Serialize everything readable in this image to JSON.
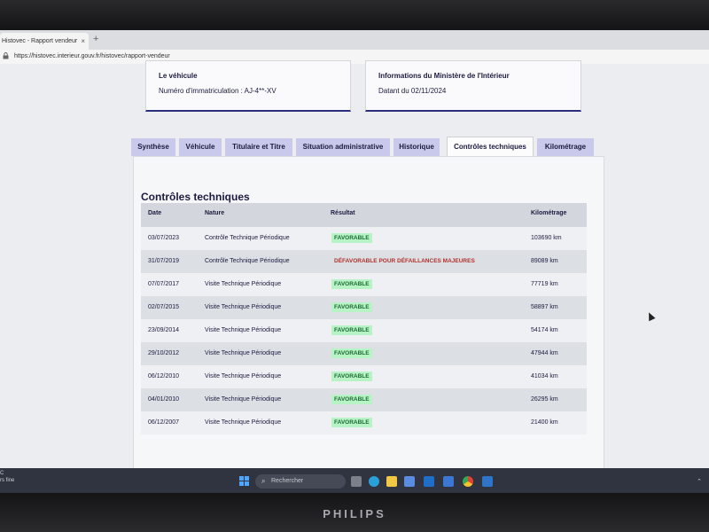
{
  "browser": {
    "tab_title": "Histovec - Rapport vendeur",
    "tab_close": "×",
    "new_tab": "+",
    "url": "https://histovec.interieur.gouv.fr/histovec/rapport-vendeur"
  },
  "cards": {
    "vehicle": {
      "title": "Le véhicule",
      "text": "Numéro d'immatriculation : AJ-4**-XV"
    },
    "ministry": {
      "title": "Informations du Ministère de l'Intérieur",
      "text": "Datant du 02/11/2024"
    }
  },
  "tabs": [
    {
      "label": "Synthèse",
      "active": false
    },
    {
      "label": "Véhicule",
      "active": false
    },
    {
      "label": "Titulaire et Titre",
      "active": false
    },
    {
      "label": "Situation administrative",
      "active": false
    },
    {
      "label": "Historique",
      "active": false
    },
    {
      "label": "Contrôles techniques",
      "active": true
    },
    {
      "label": "Kilométrage",
      "active": false
    }
  ],
  "section": {
    "title": "Contrôles techniques",
    "headers": [
      "Date",
      "Nature",
      "Résultat",
      "Kilométrage"
    ],
    "rows": [
      {
        "date": "03/07/2023",
        "nature": "Contrôle Technique Périodique",
        "result": "FAVORABLE",
        "favorable": true,
        "km": "103690 km"
      },
      {
        "date": "31/07/2019",
        "nature": "Contrôle Technique Périodique",
        "result": "DÉFAVORABLE POUR DÉFAILLANCES MAJEURES",
        "favorable": false,
        "km": "89089 km"
      },
      {
        "date": "07/07/2017",
        "nature": "Visite Technique Périodique",
        "result": "FAVORABLE",
        "favorable": true,
        "km": "77719 km"
      },
      {
        "date": "02/07/2015",
        "nature": "Visite Technique Périodique",
        "result": "FAVORABLE",
        "favorable": true,
        "km": "58897 km"
      },
      {
        "date": "23/09/2014",
        "nature": "Visite Technique Périodique",
        "result": "FAVORABLE",
        "favorable": true,
        "km": "54174 km"
      },
      {
        "date": "29/10/2012",
        "nature": "Visite Technique Périodique",
        "result": "FAVORABLE",
        "favorable": true,
        "km": "47944 km"
      },
      {
        "date": "06/12/2010",
        "nature": "Visite Technique Périodique",
        "result": "FAVORABLE",
        "favorable": true,
        "km": "41034 km"
      },
      {
        "date": "04/01/2010",
        "nature": "Visite Technique Périodique",
        "result": "FAVORABLE",
        "favorable": true,
        "km": "26295 km"
      },
      {
        "date": "06/12/2007",
        "nature": "Visite Technique Périodique",
        "result": "FAVORABLE",
        "favorable": true,
        "km": "21400 km"
      }
    ]
  },
  "taskbar": {
    "search_placeholder": "Rechercher",
    "weather_line1": "C",
    "weather_line2": "rs fine"
  },
  "monitor": {
    "brand": "PHILIPS"
  },
  "colors": {
    "accent_navy": "#2b2e7a",
    "tab_purple": "#c9c9ec",
    "badge_green_bg": "#b8f3c6",
    "badge_red_text": "#b2302c"
  }
}
